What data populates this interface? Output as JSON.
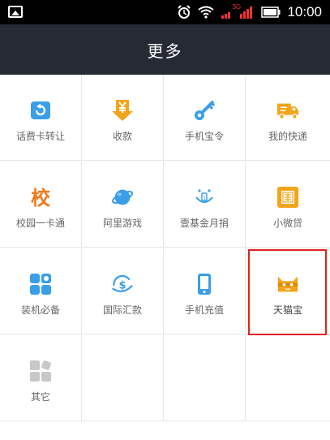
{
  "status_bar": {
    "time": "10:00",
    "network_label": "3G"
  },
  "header": {
    "title": "更多"
  },
  "colors": {
    "blue": "#3a9ee8",
    "orange": "#f2a51b",
    "header_bg": "#252a35",
    "highlight": "#e02020",
    "gray_icon": "#c8c8c8"
  },
  "items": [
    {
      "label": "话费卡转让",
      "icon": "card-refresh-icon"
    },
    {
      "label": "收款",
      "icon": "yen-arrow-icon"
    },
    {
      "label": "手机宝令",
      "icon": "key-icon"
    },
    {
      "label": "我的快递",
      "icon": "delivery-truck-icon"
    },
    {
      "label": "校园一卡通",
      "icon": "school-character-icon"
    },
    {
      "label": "阿里游戏",
      "icon": "game-planet-icon"
    },
    {
      "label": "壹基金月捐",
      "icon": "smile-charity-icon"
    },
    {
      "label": "小微贷",
      "icon": "loan-seal-icon"
    },
    {
      "label": "装机必备",
      "icon": "app-grid-icon"
    },
    {
      "label": "国际汇款",
      "icon": "dollar-globe-icon"
    },
    {
      "label": "手机充值",
      "icon": "phone-icon"
    },
    {
      "label": "天猫宝",
      "icon": "tmall-cat-icon"
    },
    {
      "label": "其它",
      "icon": "other-grid-icon"
    }
  ]
}
